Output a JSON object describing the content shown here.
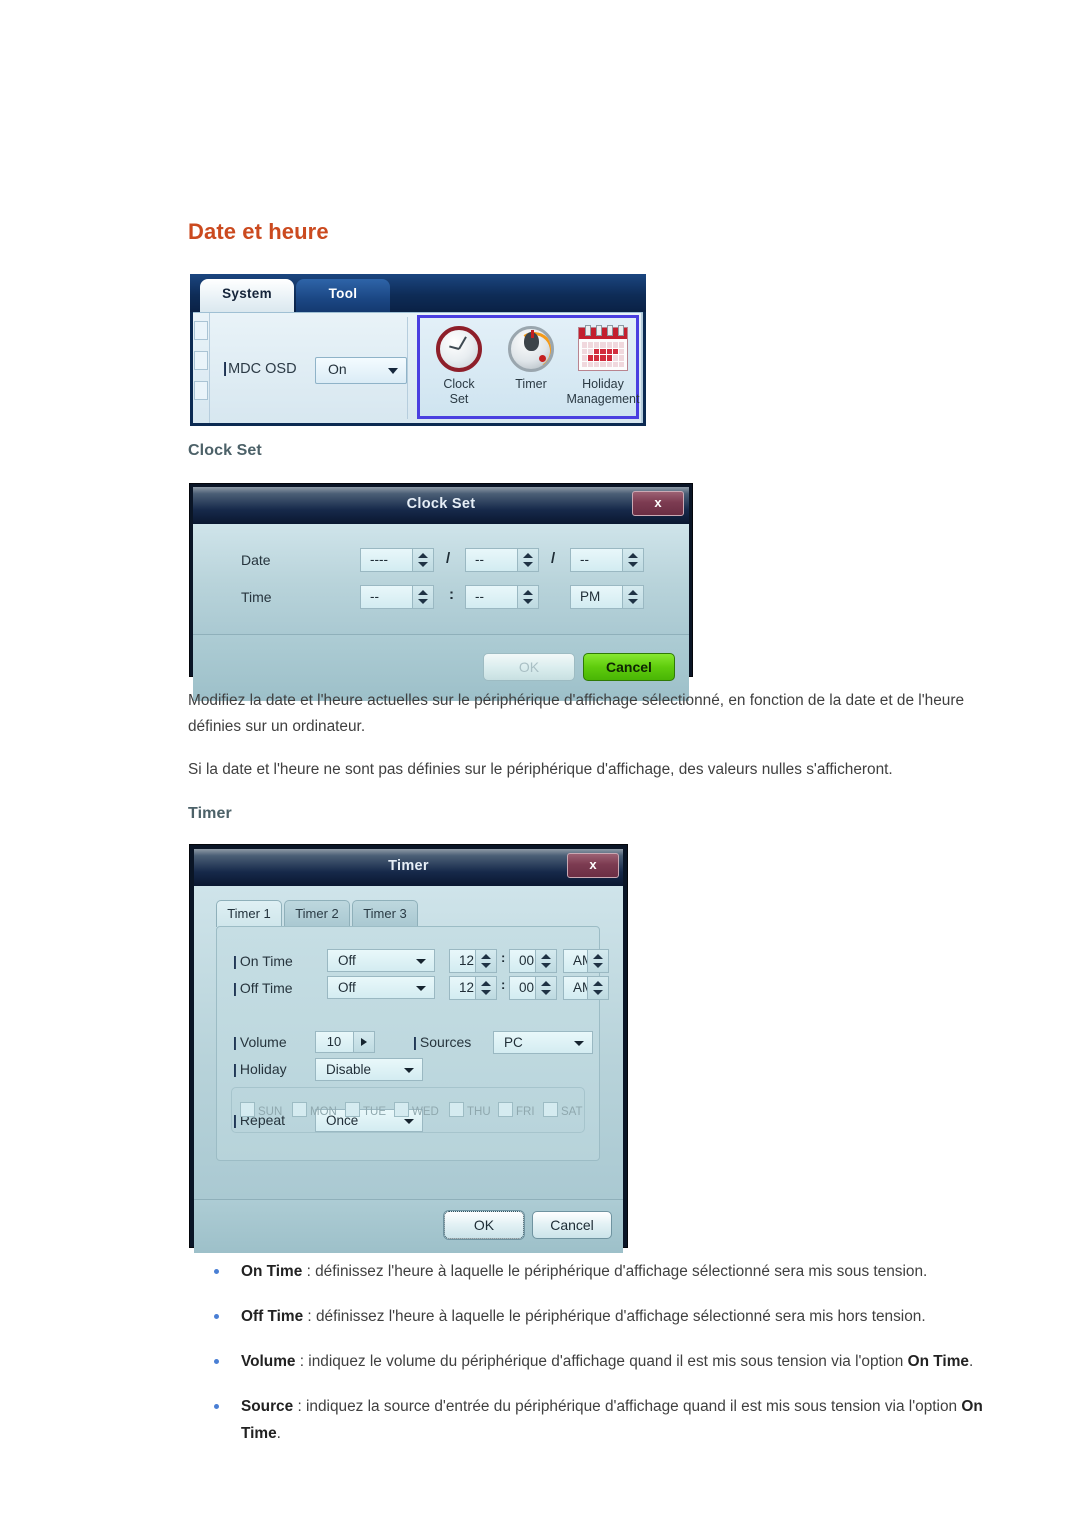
{
  "page": {
    "heading": "Date et heure",
    "sub_clock": "Clock Set",
    "sub_timer": "Timer",
    "accent_heading": "#cb4a1f",
    "accent_sub": "#4c6168",
    "paragraphs": [
      "Modifiez la date et l'heure actuelles sur le périphérique d'affichage sélectionné, en fonction de la date et de l'heure définies sur un ordinateur.",
      "Si la date et l'heure ne sont pas définies sur le périphérique d'affichage, des valeurs nulles s'afficheront."
    ]
  },
  "system_panel": {
    "tabs": [
      {
        "label": "System",
        "active": true
      },
      {
        "label": "Tool",
        "active": false
      }
    ],
    "field": {
      "label": "MDC OSD",
      "value": "On"
    },
    "icons": [
      {
        "name": "clock-set",
        "line1": "Clock",
        "line2": "Set"
      },
      {
        "name": "timer",
        "line1": "Timer",
        "line2": ""
      },
      {
        "name": "holiday-management",
        "line1": "Holiday",
        "line2": "Management"
      }
    ],
    "highlight_color": "#4a3fe0"
  },
  "clock_dialog": {
    "title": "Clock Set",
    "close_label": "x",
    "rows": [
      {
        "label": "Date",
        "fields": [
          "----",
          "--",
          "--"
        ],
        "separators": [
          "/",
          "/"
        ]
      },
      {
        "label": "Time",
        "fields": [
          "--",
          "--",
          "PM"
        ],
        "separators": [
          ":",
          ""
        ]
      }
    ],
    "buttons": [
      {
        "label": "OK",
        "state": "disabled"
      },
      {
        "label": "Cancel",
        "state": "green"
      }
    ]
  },
  "timer_dialog": {
    "title": "Timer",
    "close_label": "x",
    "tabs": [
      {
        "label": "Timer 1",
        "active": true
      },
      {
        "label": "Timer 2",
        "active": false
      },
      {
        "label": "Timer 3",
        "active": false
      }
    ],
    "on_time": {
      "label": "On Time",
      "mode": "Off",
      "hour": "12",
      "minute": "00",
      "meridiem": "AM",
      "sep": ":"
    },
    "off_time": {
      "label": "Off Time",
      "mode": "Off",
      "hour": "12",
      "minute": "00",
      "meridiem": "AM",
      "sep": ":"
    },
    "volume": {
      "label": "Volume",
      "value": "10"
    },
    "sources": {
      "label": "Sources",
      "value": "PC"
    },
    "holiday": {
      "label": "Holiday",
      "value": "Disable"
    },
    "repeat": {
      "label": "Repeat",
      "value": "Once"
    },
    "days": [
      "SUN",
      "MON",
      "TUE",
      "WED",
      "THU",
      "FRI",
      "SAT"
    ],
    "buttons": [
      {
        "label": "OK",
        "state": "focus"
      },
      {
        "label": "Cancel",
        "state": "normal"
      }
    ]
  },
  "bullets": [
    {
      "term": "On Time",
      "text": " : définissez l'heure à laquelle le périphérique d'affichage sélectionné sera mis sous tension."
    },
    {
      "term": "Off Time",
      "text": " : définissez l'heure à laquelle le périphérique d'affichage sélectionné sera mis hors tension."
    },
    {
      "term": "Volume",
      "text": " : indiquez le volume du périphérique d'affichage quand il est mis sous tension via l'option ",
      "term2": "On Time",
      "tail": "."
    },
    {
      "term": "Source",
      "text": " : indiquez la source d'entrée du périphérique d'affichage quand il est mis sous tension via l'option ",
      "term2": "On Time",
      "tail": "."
    }
  ]
}
